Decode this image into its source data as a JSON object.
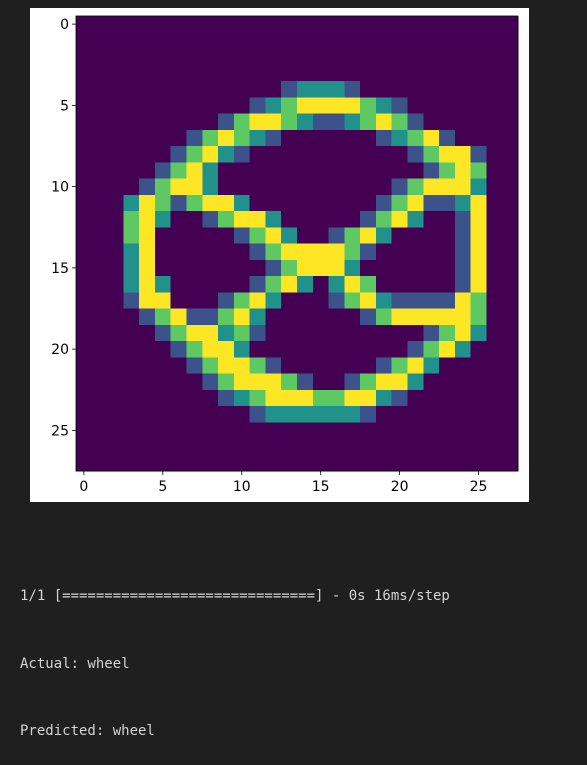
{
  "colors": {
    "page_background": "#1f1f1f",
    "figure_background": "#ffffff",
    "output_text": "#d4d4d4",
    "colormap": [
      "#440154",
      "#3b528b",
      "#21918c",
      "#5ec962",
      "#fde725"
    ]
  },
  "chart_data": {
    "type": "heatmap",
    "title": "",
    "xlabel": "",
    "ylabel": "",
    "colormap": "viridis",
    "grid": false,
    "xlim": [
      -0.5,
      27.5
    ],
    "ylim": [
      27.5,
      -0.5
    ],
    "x_ticks": [
      0,
      5,
      10,
      15,
      20,
      25
    ],
    "y_ticks": [
      0,
      5,
      10,
      15,
      20,
      25
    ],
    "x_tick_labels": [
      "0",
      "5",
      "10",
      "15",
      "20",
      "25"
    ],
    "y_tick_labels": [
      "0",
      "5",
      "10",
      "15",
      "20",
      "25"
    ],
    "rows": [
      "0000000000000000000000000000",
      "0000000000000000000000000000",
      "0000000000000000000000000000",
      "0000000000000000000000000000",
      "0000000000000122210000000000",
      "0000000000012344443210000000",
      "0000000001344321123431000000",
      "0000000134321000000123410000",
      "0000001342100000000001344100",
      "0000013420000000000000134300",
      "0000134420000000000013444200",
      "0002431344200000000134112400",
      "0003420013442000001342001400",
      "0003400000134200134200001400",
      "0002400000013444431000001400",
      "0002400000001344420000001400",
      "0002420000013420243000001400",
      "0001440001342000134211114300",
      "0000134113420000001344444300",
      "0000013442310000000000134200",
      "0000001344200000000001342000",
      "0000000134431000000134200000",
      "0000000013444310013442000000",
      "0000000001234443344210000000",
      "0000000000012222221000000000",
      "0000000000000000000000000000",
      "0000000000000000000000000000",
      "0000000000000000000000000000"
    ]
  },
  "output": {
    "progress_line": "1/1 [==============================] - 0s 16ms/step",
    "actual_line": "Actual: wheel",
    "predicted_line": "Predicted: wheel"
  }
}
